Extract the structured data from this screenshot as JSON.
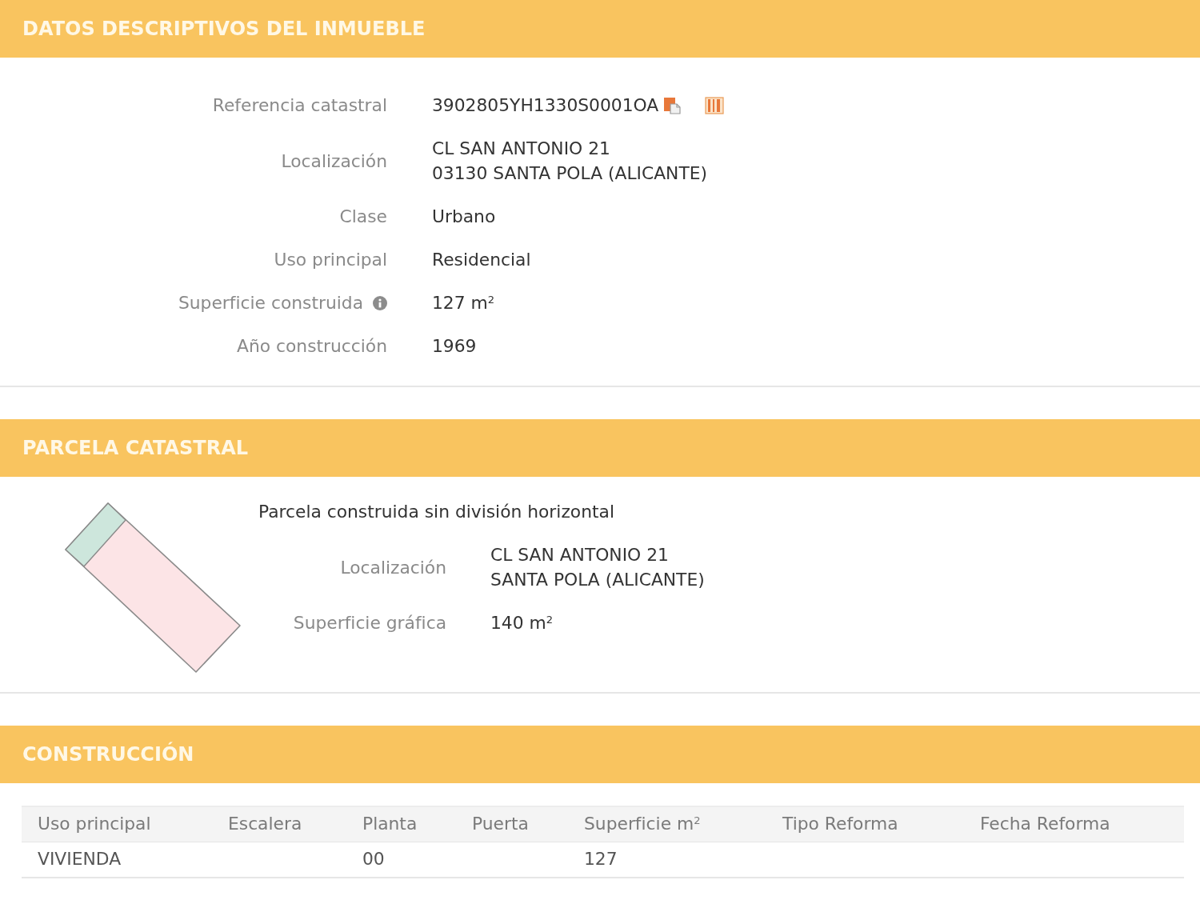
{
  "property_details": {
    "title": "DATOS DESCRIPTIVOS DEL INMUEBLE",
    "fields": [
      {
        "kind": "reference",
        "label": "Referencia catastral",
        "value": "3902805YH1330S0001OA"
      },
      {
        "kind": "plain",
        "label": "Localización",
        "value": "CL SAN ANTONIO 21\n03130 SANTA POLA (ALICANTE)"
      },
      {
        "kind": "plain",
        "label": "Clase",
        "value": "Urbano"
      },
      {
        "kind": "plain",
        "label": "Uso principal",
        "value": "Residencial"
      },
      {
        "kind": "info",
        "label": "Superficie construida",
        "value": "127 m$^{2}$"
      },
      {
        "kind": "plain",
        "label": "Año construcción",
        "value": "1969"
      }
    ]
  },
  "parcel": {
    "title": "PARCELA CATASTRAL",
    "description": "Parcela construida sin división horizontal",
    "fields": [
      {
        "label": "Localización",
        "value": "CL SAN ANTONIO 21\nSANTA POLA (ALICANTE)"
      },
      {
        "label": "Superficie gráfica",
        "value": "140 m$^{2}$"
      }
    ]
  },
  "construction": {
    "title": "CONSTRUCCIÓN",
    "table": {
      "columns": [
        "Uso principal",
        "Escalera",
        "Planta",
        "Puerta",
        "Superficie m$^{2}$",
        "Tipo Reforma",
        "Fecha Reforma"
      ],
      "rows": [
        {
          "cells": [
            "VIVIENDA",
            null,
            "00",
            null,
            "127",
            null,
            null
          ]
        }
      ]
    }
  }
}
